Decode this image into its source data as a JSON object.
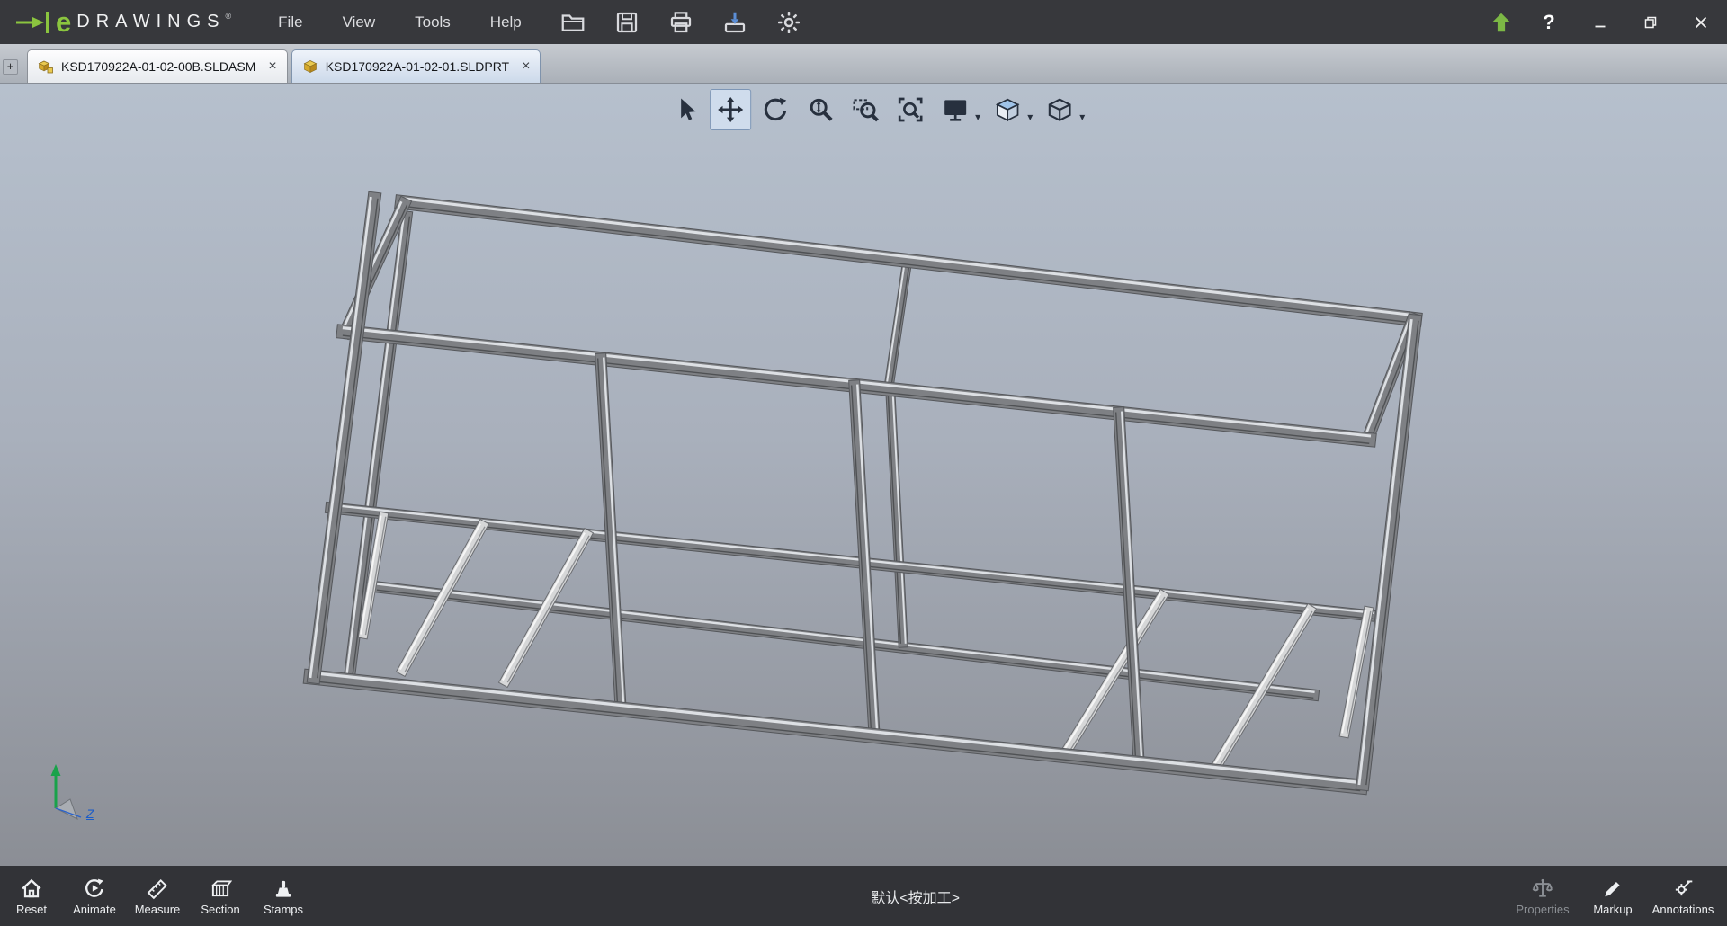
{
  "titlebar": {
    "logo_e": "e",
    "logo_text": "DRAWINGS",
    "logo_reg": "®",
    "menus": [
      {
        "label": "File"
      },
      {
        "label": "View"
      },
      {
        "label": "Tools"
      },
      {
        "label": "Help"
      }
    ],
    "help_label": "?"
  },
  "tabs": {
    "add_label": "+",
    "items": [
      {
        "label": "KSD170922A-01-02-00B.SLDASM",
        "type": "assembly",
        "active": false,
        "close": "×"
      },
      {
        "label": "KSD170922A-01-02-01.SLDPRT",
        "type": "part",
        "active": true,
        "close": "×"
      }
    ]
  },
  "view_toolbar": {
    "caret_glyph": "▾",
    "active_tool": "pan",
    "tools": [
      "select",
      "pan",
      "rotate",
      "zoom-in-out",
      "zoom-area",
      "zoom-fit",
      "display-style",
      "appearances",
      "view-orientation"
    ]
  },
  "triad": {
    "z_label": "Z"
  },
  "bottom_toolbar": {
    "left": [
      {
        "label": "Reset"
      },
      {
        "label": "Animate"
      },
      {
        "label": "Measure"
      },
      {
        "label": "Section"
      },
      {
        "label": "Stamps"
      }
    ],
    "center_text": "默认<按加工>",
    "right": [
      {
        "label": "Properties",
        "disabled": true
      },
      {
        "label": "Markup",
        "disabled": false
      },
      {
        "label": "Annotations",
        "disabled": false
      }
    ]
  },
  "colors": {
    "brand_green": "#8bc53f",
    "titlebar_bg": "#37383c",
    "viewport_top": "#b6c0cd",
    "viewport_bottom": "#8b8e95",
    "beam_gray": "#7e8084",
    "beam_light": "#d6d7d8",
    "active_tool_bg": "#cfdcec"
  }
}
